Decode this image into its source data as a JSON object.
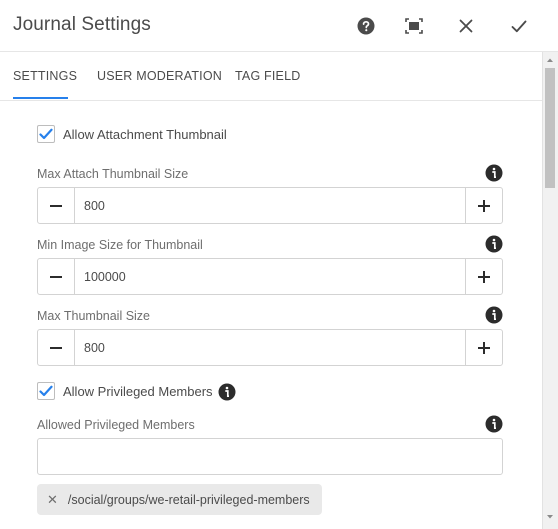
{
  "dialog": {
    "title": "Journal Settings"
  },
  "toolbar": {
    "help_icon": "help-icon",
    "fullscreen_icon": "fullscreen-icon",
    "close_icon": "close-icon",
    "confirm_icon": "checkmark-icon"
  },
  "tabs": [
    {
      "label": "SETTINGS",
      "active": true
    },
    {
      "label": "USER MODERATION",
      "active": false
    },
    {
      "label": "TAG FIELD",
      "active": false
    }
  ],
  "settings": {
    "allow_attachment_thumbnail": {
      "label": "Allow Attachment Thumbnail",
      "checked": true
    },
    "max_attach_thumbnail_size": {
      "label": "Max Attach Thumbnail Size",
      "value": "800"
    },
    "min_image_size_for_thumbnail": {
      "label": "Min Image Size for Thumbnail",
      "value": "100000"
    },
    "max_thumbnail_size": {
      "label": "Max Thumbnail Size",
      "value": "800"
    },
    "allow_privileged_members": {
      "label": "Allow Privileged Members",
      "checked": true
    },
    "allowed_privileged_members": {
      "label": "Allowed Privileged Members",
      "value": "",
      "tags": [
        "/social/groups/we-retail-privileged-members"
      ]
    }
  },
  "colors": {
    "accent": "#2680eb",
    "text": "#4b4b4b",
    "border": "#d3d3d3"
  }
}
